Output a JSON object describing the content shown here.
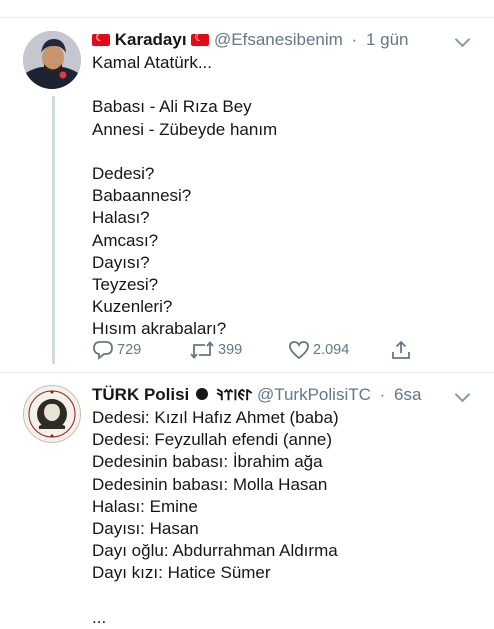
{
  "tweet1": {
    "display_name": "Karadayı",
    "handle": "@Efsanesibenim",
    "separator": "·",
    "time": "1 gün",
    "lines": [
      "Kamal Atatürk...",
      "",
      "Babası - Ali Rıza Bey",
      "Annesi - Zübeyde hanım",
      "",
      "Dedesi?",
      "Babaannesi?",
      "Halası?",
      "Amcası?",
      "Dayısı?",
      "Teyzesi?",
      "Kuzenleri?",
      "Hısım akrabaları?"
    ],
    "replies": "729",
    "retweets": "399",
    "likes": "2.094"
  },
  "tweet2": {
    "display_name": "TÜRK Polisi",
    "old_turkic": "𐰃𐰏𐰾𐰼𐰚",
    "handle": "@TurkPolisiTC",
    "separator": "·",
    "time": "6sa",
    "lines": [
      "Dedesi: Kızıl Hafız Ahmet (baba)",
      "Dedesi: Feyzullah efendi (anne)",
      "Dedesinin babası: İbrahim ağa",
      "Dedesinin babası: Molla Hasan",
      "Halası: Emine",
      "Dayısı: Hasan",
      "Dayı oğlu: Abdurrahman Aldırma",
      "Dayı kızı: Hatice Sümer",
      "",
      "..."
    ]
  },
  "icons": {
    "reply": "reply-icon",
    "retweet": "retweet-icon",
    "like": "heart-icon",
    "share": "share-icon",
    "menu": "chevron-down-icon",
    "flag": "turkish-flag-icon"
  },
  "colors": {
    "text": "#14171a",
    "muted": "#657786",
    "thread_line": "#cfd9de",
    "flag_red": "#e30a17"
  }
}
